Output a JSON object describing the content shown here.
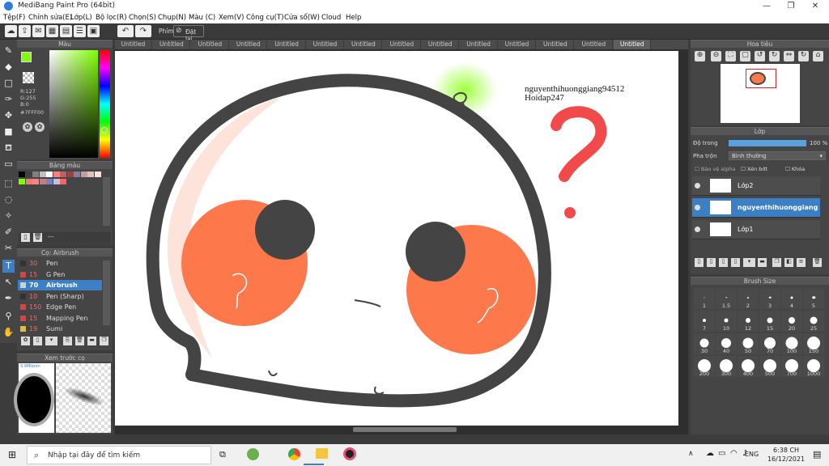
{
  "window": {
    "title": "MediBang Paint Pro (64bit)",
    "minimize": "—",
    "maximize": "❐",
    "close": "✕"
  },
  "menu": [
    "Tệp(F)",
    "Chỉnh sửa(E)",
    "Lớp(L)",
    "Bộ lọc(R)",
    "Chọn(S)",
    "Chụp(N)",
    "Màu (C)",
    "Xem(V)",
    "Công cụ(T)",
    "Cửa sổ(W)",
    "Cloud",
    "Help"
  ],
  "toolbar": {
    "shortcut_label": "Phím",
    "reset_label": "Đặt lại"
  },
  "tabs": [
    "Untitled",
    "Untitled",
    "Untitled",
    "Untitled",
    "Untitled",
    "Untitled",
    "Untitled",
    "Untitled",
    "Untitled",
    "Untitled",
    "Untitled",
    "Untitled",
    "Untitled",
    "Untitled"
  ],
  "color_panel": {
    "title": "Màu",
    "r": "R:127",
    "g": "G:255",
    "b": "B:0",
    "hex": "#7FFF00",
    "fg_color": "#7fff00"
  },
  "palette_panel": {
    "title": "Bảng màu",
    "footer": "---",
    "colors": [
      "#000000",
      "#404040",
      "#808080",
      "#c0c0c0",
      "#ffffff",
      "#ff8080",
      "#c06060",
      "#a04040",
      "#8080a0",
      "#c0a0a0",
      "#e0c0c0",
      "#ffe0e0",
      "#80ff00",
      "#e08080",
      "#ff8080",
      "#c08080",
      "#8080c0",
      "#c0c0e0",
      "#ff6060"
    ]
  },
  "brush_panel": {
    "title": "Cọ: Airbrush",
    "items": [
      {
        "size": "30",
        "name": "Pen",
        "color": "#333333"
      },
      {
        "size": "15",
        "name": "G Pen",
        "color": "#e04040"
      },
      {
        "size": "70",
        "name": "Airbrush",
        "color": "#d0d0d0"
      },
      {
        "size": "10",
        "name": "Pen (Sharp)",
        "color": "#333333"
      },
      {
        "size": "150",
        "name": "Edge Pen",
        "color": "#e04040"
      },
      {
        "size": "15",
        "name": "Mapping Pen",
        "color": "#e04040"
      },
      {
        "size": "19",
        "name": "Sumi",
        "color": "#e0c030"
      }
    ]
  },
  "brush_preview": {
    "title": "Xem trước cọ",
    "label": "S 9Mlenm"
  },
  "canvas_text": {
    "watermark1": "nguyenthihuonggiang94512",
    "watermark2": "Hoidap247"
  },
  "navigator": {
    "title": "Hoa tiêu"
  },
  "layer_panel": {
    "title": "Lớp",
    "opacity_label": "Độ trong",
    "opacity_value": "100 %",
    "opacity": 1.0,
    "blend_label": "Pha trộn",
    "blend_value": "Bình thường",
    "protect_alpha": "Bảo vệ alpha",
    "clipping": "Xén bớt",
    "lock": "Khóa",
    "layers": [
      {
        "name": "Lớp2",
        "active": false
      },
      {
        "name": "nguyenthihuonggiang",
        "active": true
      },
      {
        "name": "Lớp1",
        "active": false
      }
    ]
  },
  "brush_size_panel": {
    "title": "Brush Size",
    "sizes": [
      "1",
      "1.5",
      "2",
      "3",
      "4",
      "5",
      "7",
      "10",
      "12",
      "15",
      "20",
      "25",
      "30",
      "40",
      "50",
      "70",
      "100",
      "150",
      "200",
      "300",
      "400",
      "500",
      "700",
      "1000"
    ]
  },
  "taskbar": {
    "search_placeholder": "Nhập tại đây để tìm kiếm",
    "lang": "ENG",
    "time": "6:38 CH",
    "date": "16/12/2021"
  }
}
